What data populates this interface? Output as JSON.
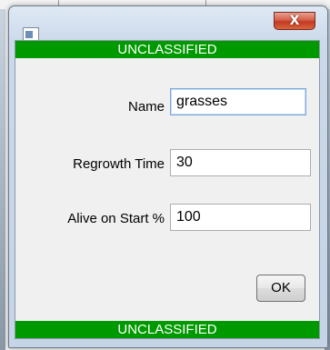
{
  "dialog": {
    "banner_top": "UNCLASSIFIED",
    "banner_bottom": "UNCLASSIFIED",
    "close_symbol": "X",
    "fields": {
      "name": {
        "label": "Name",
        "value": "grasses"
      },
      "regrowth_time": {
        "label": "Regrowth Time",
        "value": "30"
      },
      "alive_on_start": {
        "label": "Alive on Start %",
        "value": "100"
      }
    },
    "ok_label": "OK"
  },
  "colors": {
    "banner": "#009a00",
    "close_button": "#c23a22",
    "focus_border": "#7aa7d6"
  }
}
